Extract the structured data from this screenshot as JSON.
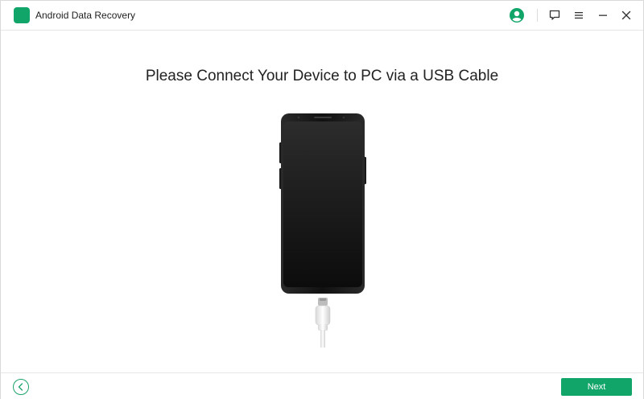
{
  "app": {
    "title": "Android Data Recovery",
    "logo_color": "#12a56a"
  },
  "titlebar": {
    "icons": [
      "user-icon",
      "feedback-icon",
      "menu-icon",
      "minimize-icon",
      "close-icon"
    ],
    "accent_color": "#12a56a"
  },
  "main": {
    "heading": "Please Connect Your Device to PC via a USB Cable"
  },
  "footer": {
    "back_icon": "chevron-left-icon",
    "next_label": "Next",
    "next_color": "#12a56a"
  }
}
